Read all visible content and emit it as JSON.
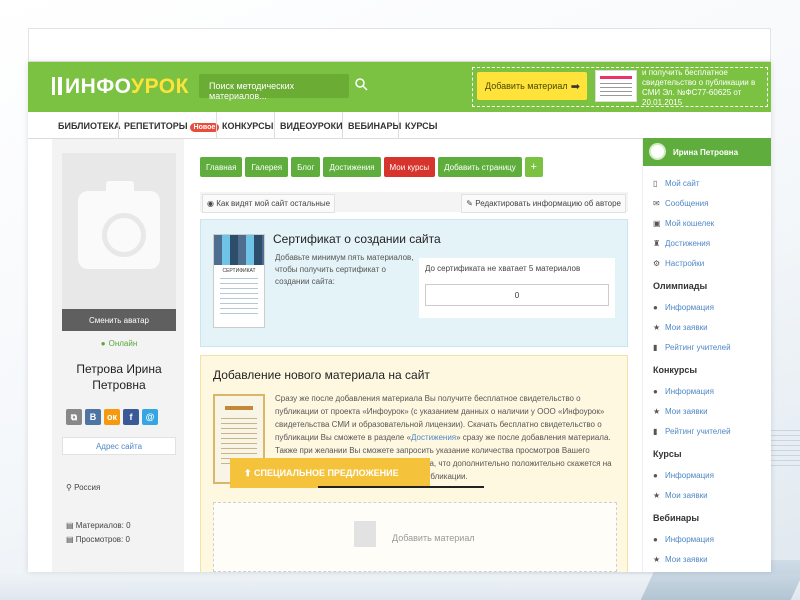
{
  "header": {
    "logo_a": "ИНФО",
    "logo_b": "УРОК",
    "search_placeholder": "Поиск методических материалов...",
    "add_material": "Добавить материал",
    "promo": "и получить бесплатное свидетельство о публикации в СМИ Эл. №ФС77-60625 от 20.01.2015"
  },
  "nav": [
    "БИБЛИОТЕКА",
    "РЕПЕТИТОРЫ",
    "КОНКУРСЫ",
    "ВИДЕОУРОКИ",
    "ВЕБИНАРЫ",
    "КУРСЫ"
  ],
  "nav_badge": "Новое",
  "profile": {
    "change_avatar": "Сменить аватар",
    "online": "Онлайн",
    "name": "Петрова Ирина Петровна",
    "address": "Адрес сайта",
    "country": "Россия",
    "materials": "Материалов: 0",
    "views": "Просмотров: 0"
  },
  "tabs": [
    "Главная",
    "Галерея",
    "Блог",
    "Достижения",
    "Мои курсы",
    "Добавить страницу",
    "+"
  ],
  "viewbar": {
    "left": "Как видят мой сайт остальные",
    "right": "Редактировать информацию об авторе"
  },
  "cert": {
    "title": "Сертификат о создании сайта",
    "desc": "Добавьте минимум пять материалов, чтобы получить сертификат о создании сайта:",
    "need": "До сертификата не хватает 5 материалов",
    "count": "0",
    "img_label": "СЕРТИФИКАТ"
  },
  "add": {
    "title": "Добавление нового материала на сайт",
    "text1": "Сразу же после добавления материала Вы получите бесплатное свидетельство о публикации от проекта «Инфоурок» (с указанием данных о наличии у ООО «Инфоурок» свидетельства СМИ и образовательной лицензии). Скачать бесплатно свидетельство о публикации Вы сможете в разделе «",
    "link": "Достижения",
    "text2": "» сразу же после добавления материала. Также при желании Вы сможете запросить указание количества просмотров Вашего материала другими пользователями сайта, что дополнительно положительно скажется на качестве полученного свидетельства о публикации.",
    "drop": "Добавить материал"
  },
  "special": "СПЕЦИАЛЬНОЕ ПРЕДЛОЖЕНИЕ",
  "right": {
    "user": "Ирина Петровна",
    "menu": [
      "Мой сайт",
      "Сообщения",
      "Мой кошелек",
      "Достижения",
      "Настройки"
    ],
    "sections": [
      {
        "title": "Олимпиады",
        "items": [
          "Информация",
          "Мои заявки",
          "Рейтинг учителей"
        ]
      },
      {
        "title": "Конкурсы",
        "items": [
          "Информация",
          "Мои заявки",
          "Рейтинг учителей"
        ]
      },
      {
        "title": "Курсы",
        "items": [
          "Информация",
          "Мои заявки"
        ]
      },
      {
        "title": "Вебинары",
        "items": [
          "Информация",
          "Мои заявки"
        ]
      }
    ]
  },
  "colors": {
    "brand_green": "#7bc142",
    "accent_yellow": "#ffe33a",
    "link_blue": "#4f87c6",
    "red": "#d6342c"
  }
}
